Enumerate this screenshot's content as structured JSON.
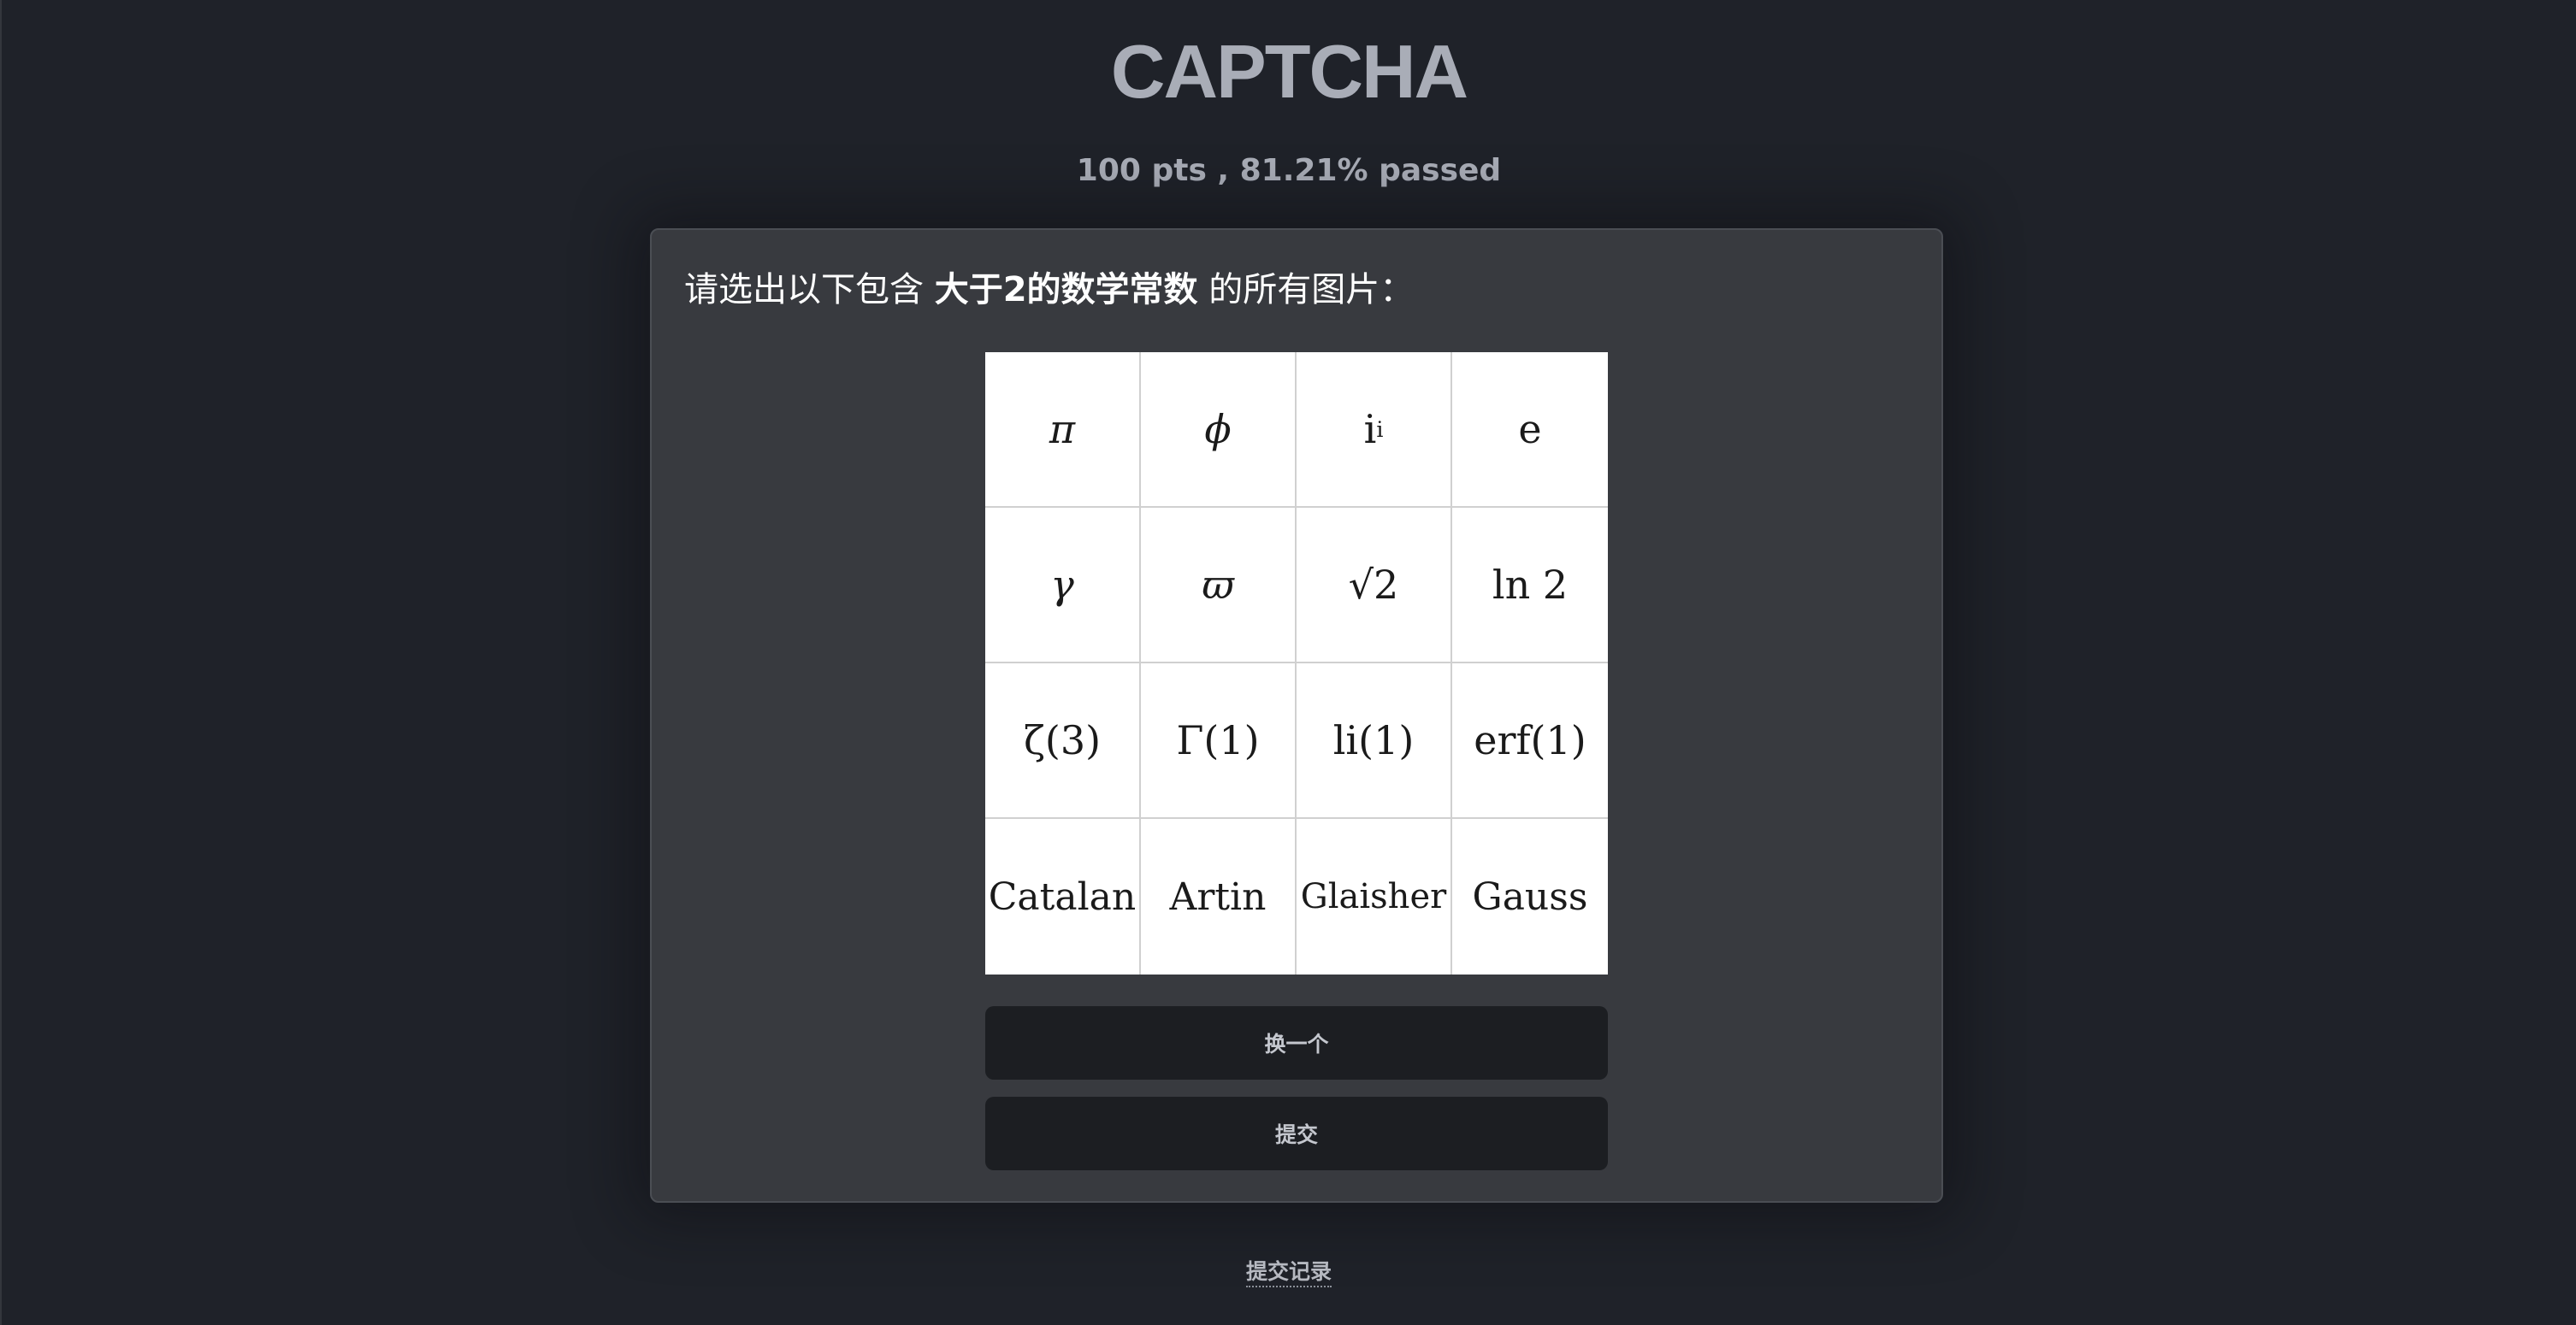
{
  "header": {
    "title": "CAPTCHA",
    "stats": "100 pts , 81.21% passed"
  },
  "challenge": {
    "prompt_prefix": "请选出以下包含 ",
    "prompt_highlight": "大于2的数学常数",
    "prompt_suffix": " 的所有图片：",
    "tiles": [
      {
        "name": "pi",
        "text": "π"
      },
      {
        "name": "phi",
        "text": "ϕ"
      },
      {
        "name": "i-to-i",
        "base": "i",
        "sup": "i"
      },
      {
        "name": "e",
        "text": "e"
      },
      {
        "name": "gamma",
        "text": "γ"
      },
      {
        "name": "varpi",
        "text": "ϖ"
      },
      {
        "name": "sqrt-2",
        "text": "√2"
      },
      {
        "name": "ln-2",
        "text": "ln 2"
      },
      {
        "name": "zeta-3",
        "text": "ζ(3)"
      },
      {
        "name": "gamma-fn-1",
        "text": "Γ(1)"
      },
      {
        "name": "li-1",
        "text": "li(1)"
      },
      {
        "name": "erf-1",
        "text": "erf(1)"
      },
      {
        "name": "catalan",
        "text": "Catalan"
      },
      {
        "name": "artin",
        "text": "Artin"
      },
      {
        "name": "glaisher",
        "text": "Glaisher"
      },
      {
        "name": "gauss",
        "text": "Gauss"
      }
    ]
  },
  "actions": {
    "refresh_label": "换一个",
    "submit_label": "提交"
  },
  "footer": {
    "history_label": "提交记录"
  }
}
